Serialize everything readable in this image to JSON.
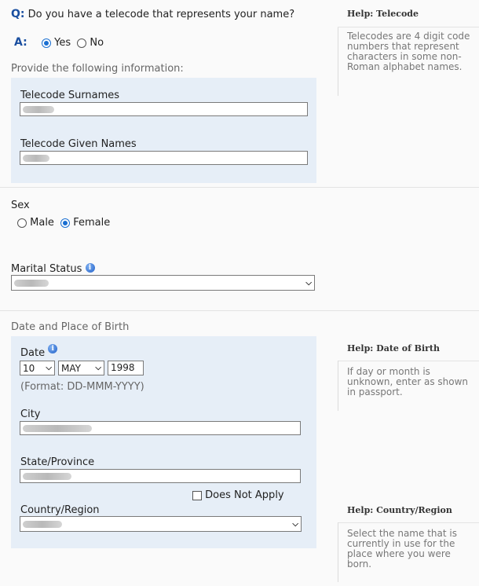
{
  "telecode": {
    "q_prefix": "Q:",
    "question": "Do you have a telecode that represents your name?",
    "a_prefix": "A:",
    "yes_label": "Yes",
    "no_label": "No",
    "selected": "Yes",
    "provide_text": "Provide the following information:",
    "surnames_label": "Telecode Surnames",
    "given_names_label": "Telecode Given Names"
  },
  "help_telecode": {
    "prefix": "Help:",
    "title": "Telecode",
    "body": "Telecodes are 4 digit code numbers that represent characters in some non-Roman alphabet names."
  },
  "sex": {
    "label": "Sex",
    "male_label": "Male",
    "female_label": "Female",
    "selected": "Female"
  },
  "marital": {
    "label": "Marital Status"
  },
  "birth": {
    "section_label": "Date and Place of Birth",
    "date_label": "Date",
    "day": "10",
    "month": "MAY",
    "year": "1998",
    "format_hint": "(Format: DD-MMM-YYYY)",
    "city_label": "City",
    "state_label": "State/Province",
    "does_not_apply": "Does Not Apply",
    "country_label": "Country/Region"
  },
  "help_dob": {
    "prefix": "Help:",
    "title": "Date of Birth",
    "body": "If day or month is unknown, enter as shown in passport."
  },
  "help_country": {
    "prefix": "Help:",
    "title": "Country/Region",
    "body": "Select the name that is currently in use for the place where you were born."
  }
}
